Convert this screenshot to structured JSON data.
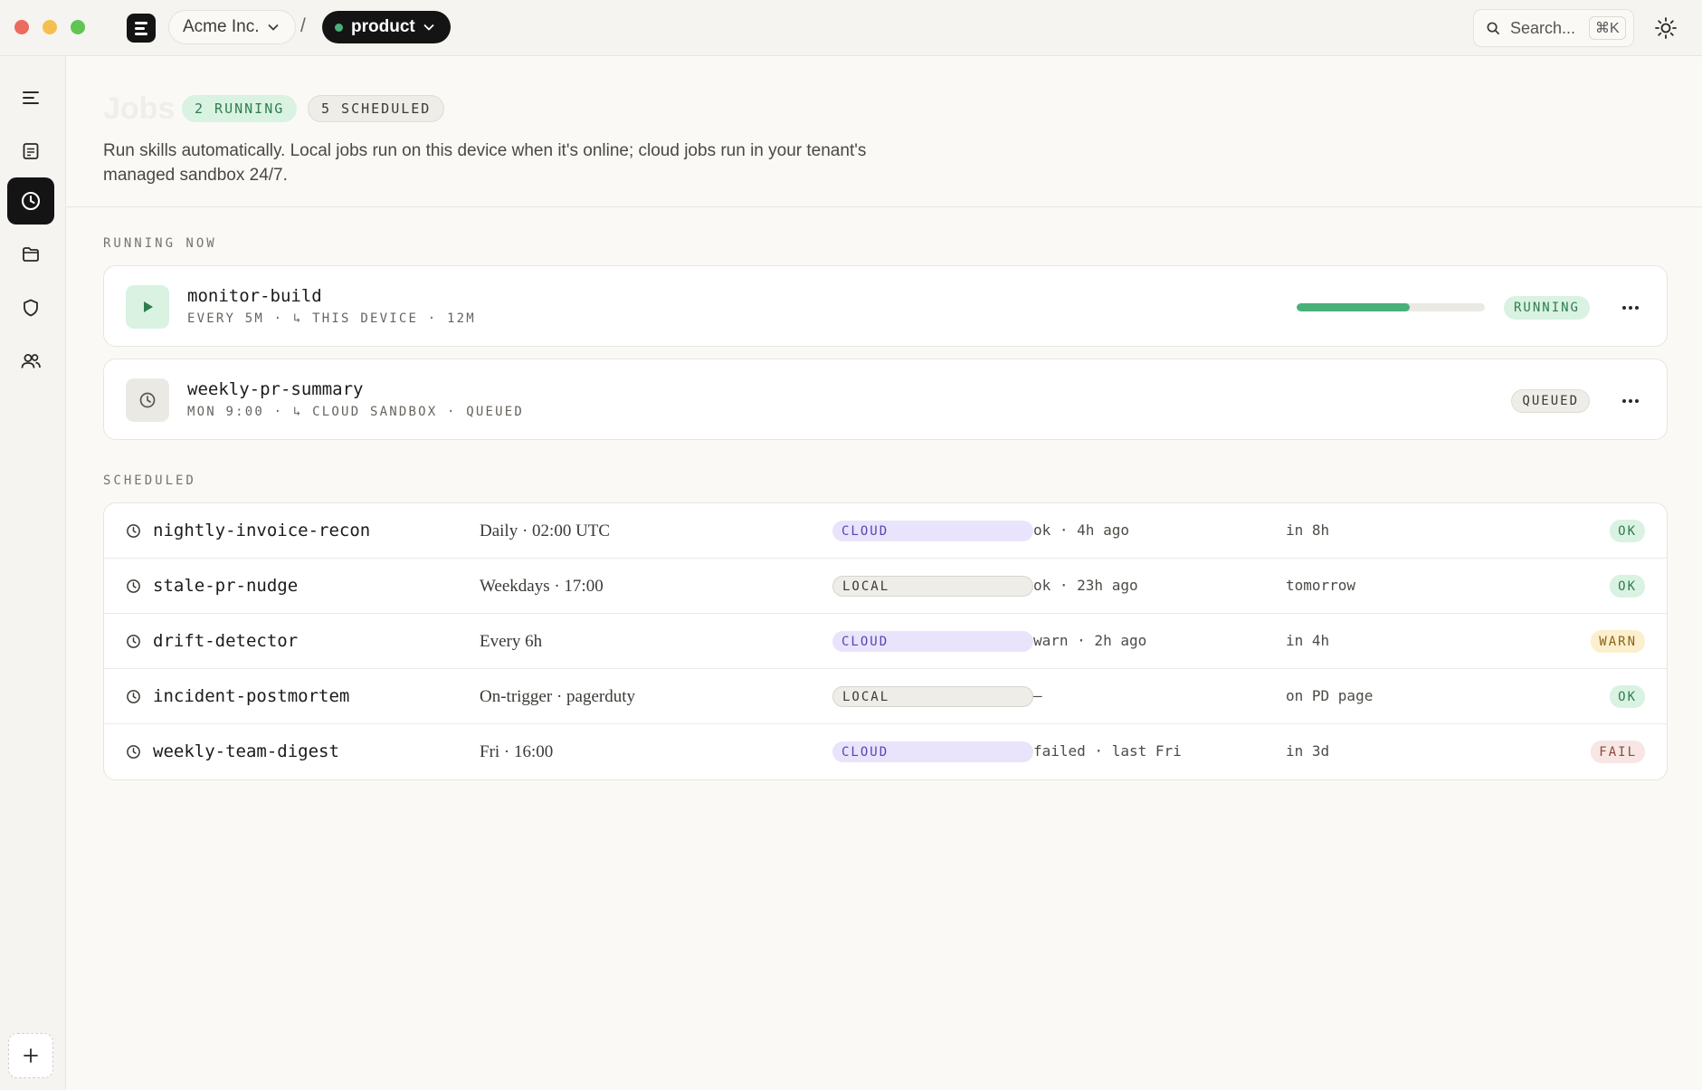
{
  "topbar": {
    "org_name": "Acme Inc.",
    "separator": "/",
    "workspace_name": "product",
    "search_placeholder": "Search...",
    "search_shortcut": "⌘K"
  },
  "sidebar": {
    "items": [
      {
        "name": "menu-icon",
        "active": false
      },
      {
        "name": "document-icon",
        "active": false
      },
      {
        "name": "clock-icon",
        "active": true
      },
      {
        "name": "folder-icon",
        "active": false
      },
      {
        "name": "shield-icon",
        "active": false
      },
      {
        "name": "users-icon",
        "active": false
      }
    ],
    "add_label": "+"
  },
  "header": {
    "title": "Jobs",
    "running_count": "2 RUNNING",
    "scheduled_count": "5 SCHEDULED",
    "description": "Run skills automatically. Local jobs run on this device when it's online; cloud jobs run in your tenant's managed sandbox 24/7."
  },
  "running_section": {
    "label": "RUNNING NOW",
    "jobs": [
      {
        "name": "monitor-build",
        "meta": "EVERY 5M · ↳ THIS DEVICE · 12M",
        "progress": 0.6,
        "status": "RUNNING",
        "icon": "play-icon"
      },
      {
        "name": "weekly-pr-summary",
        "meta": "MON 9:00 · ↳ CLOUD SANDBOX · QUEUED",
        "status": "QUEUED",
        "icon": "clock-icon"
      }
    ]
  },
  "scheduled_section": {
    "label": "SCHEDULED",
    "rows": [
      {
        "name": "nightly-invoice-recon",
        "schedule": "Daily · 02:00 UTC",
        "target": "CLOUD",
        "last_run": "ok · 4h ago",
        "next_run": "in 8h",
        "status": "OK"
      },
      {
        "name": "stale-pr-nudge",
        "schedule": "Weekdays · 17:00",
        "target": "LOCAL",
        "last_run": "ok · 23h ago",
        "next_run": "tomorrow",
        "status": "OK"
      },
      {
        "name": "drift-detector",
        "schedule": "Every 6h",
        "target": "CLOUD",
        "last_run": "warn · 2h ago",
        "next_run": "in 4h",
        "status": "WARN"
      },
      {
        "name": "incident-postmortem",
        "schedule": "On-trigger · pagerduty",
        "target": "LOCAL",
        "last_run": "—",
        "next_run": "on PD page",
        "status": "OK"
      },
      {
        "name": "weekly-team-digest",
        "schedule": "Fri · 16:00",
        "target": "CLOUD",
        "last_run": "failed · last Fri",
        "next_run": "in 3d",
        "status": "FAIL"
      }
    ]
  },
  "colors": {
    "accent_green": "#4ab07a",
    "running_bg": "#d9f2e2",
    "cloud_bg": "#e9e4fb",
    "warn_bg": "#fcefcd",
    "fail_bg": "#f7e6e3",
    "active_nav": "#141414"
  }
}
